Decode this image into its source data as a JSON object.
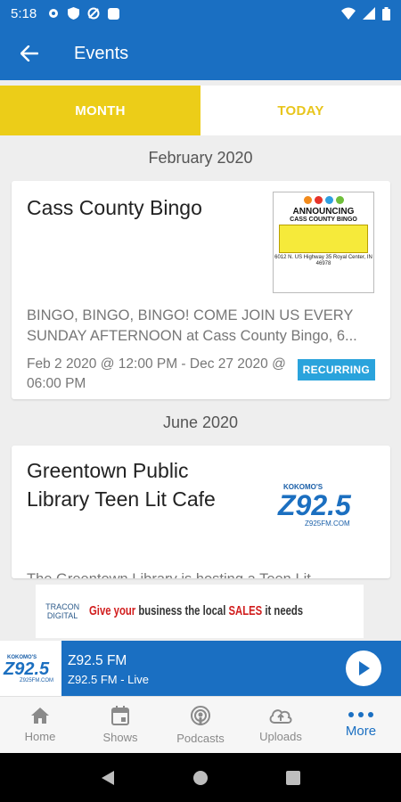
{
  "status_bar": {
    "time": "5:18"
  },
  "app_bar": {
    "title": "Events"
  },
  "tabs": [
    {
      "label": "MONTH"
    },
    {
      "label": "TODAY"
    }
  ],
  "groups": [
    {
      "month": "February 2020",
      "event": {
        "title": "Cass County Bingo",
        "description": "BINGO, BINGO, BINGO!  COME JOIN US EVERY SUNDAY AFTERNOON at Cass County Bingo, 6...",
        "date": "Feb 2 2020 @ 12:00 PM - Dec 27 2020 @ 06:00 PM",
        "badge": "RECURRING",
        "flyer": {
          "heading": "ANNOUNCING",
          "subheading": "CASS COUNTY BINGO",
          "address": "6012 N. US Highway 35 Royal Center, IN 46978"
        }
      }
    },
    {
      "month": "June 2020",
      "event": {
        "title": "Greentown Public Library Teen Lit Cafe",
        "description": "The Greentown Library is hosting a Teen Lit",
        "logo": {
          "top": "KOKOMO'S",
          "main": "Z92.5",
          "url": "Z925FM.COM"
        }
      }
    }
  ],
  "ad": {
    "brand": "TRACON DIGITAL",
    "text_1": "Give your",
    "text_2": " business the local ",
    "text_3": "SALES",
    "text_4": " it needs"
  },
  "player": {
    "title": "Z92.5 FM",
    "subtitle": "Z92.5 FM - Live",
    "art": {
      "top": "KOKOMO'S",
      "main": "Z92.5",
      "url": "Z925FM.COM"
    }
  },
  "bottom_nav": [
    {
      "label": "Home",
      "icon": "home-icon"
    },
    {
      "label": "Shows",
      "icon": "calendar-icon"
    },
    {
      "label": "Podcasts",
      "icon": "podcast-icon"
    },
    {
      "label": "Uploads",
      "icon": "upload-cloud-icon"
    },
    {
      "label": "More",
      "icon": "more-dots-icon"
    }
  ],
  "colors": {
    "primary": "#1a6fc2",
    "tab_active": "#eccd18",
    "tab_text": "#e8c51c",
    "badge": "#2aa3dc"
  }
}
